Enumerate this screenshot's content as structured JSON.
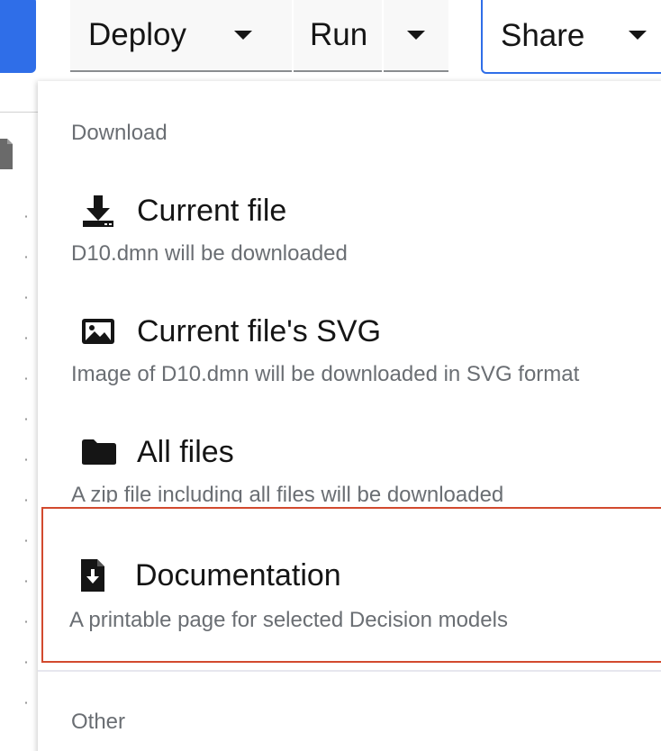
{
  "toolbar": {
    "deploy_label": "Deploy",
    "run_label": "Run",
    "share_label": "Share"
  },
  "menu": {
    "download_group_title": "Download",
    "other_group_title": "Other",
    "items": [
      {
        "label": "Current file",
        "description": "D10.dmn will be downloaded",
        "icon": "download-icon"
      },
      {
        "label": "Current file's SVG",
        "description": "Image of D10.dmn will be downloaded in SVG format",
        "icon": "image-icon"
      },
      {
        "label": "All files",
        "description": "A zip file including all files will be downloaded",
        "icon": "folder-icon"
      },
      {
        "label": "Documentation",
        "description": "A printable page for selected Decision models",
        "icon": "file-download-icon"
      }
    ]
  },
  "colors": {
    "accent_blue": "#2f6ee8",
    "highlight_border": "#d24a2e",
    "muted_text": "#6a6e73"
  }
}
